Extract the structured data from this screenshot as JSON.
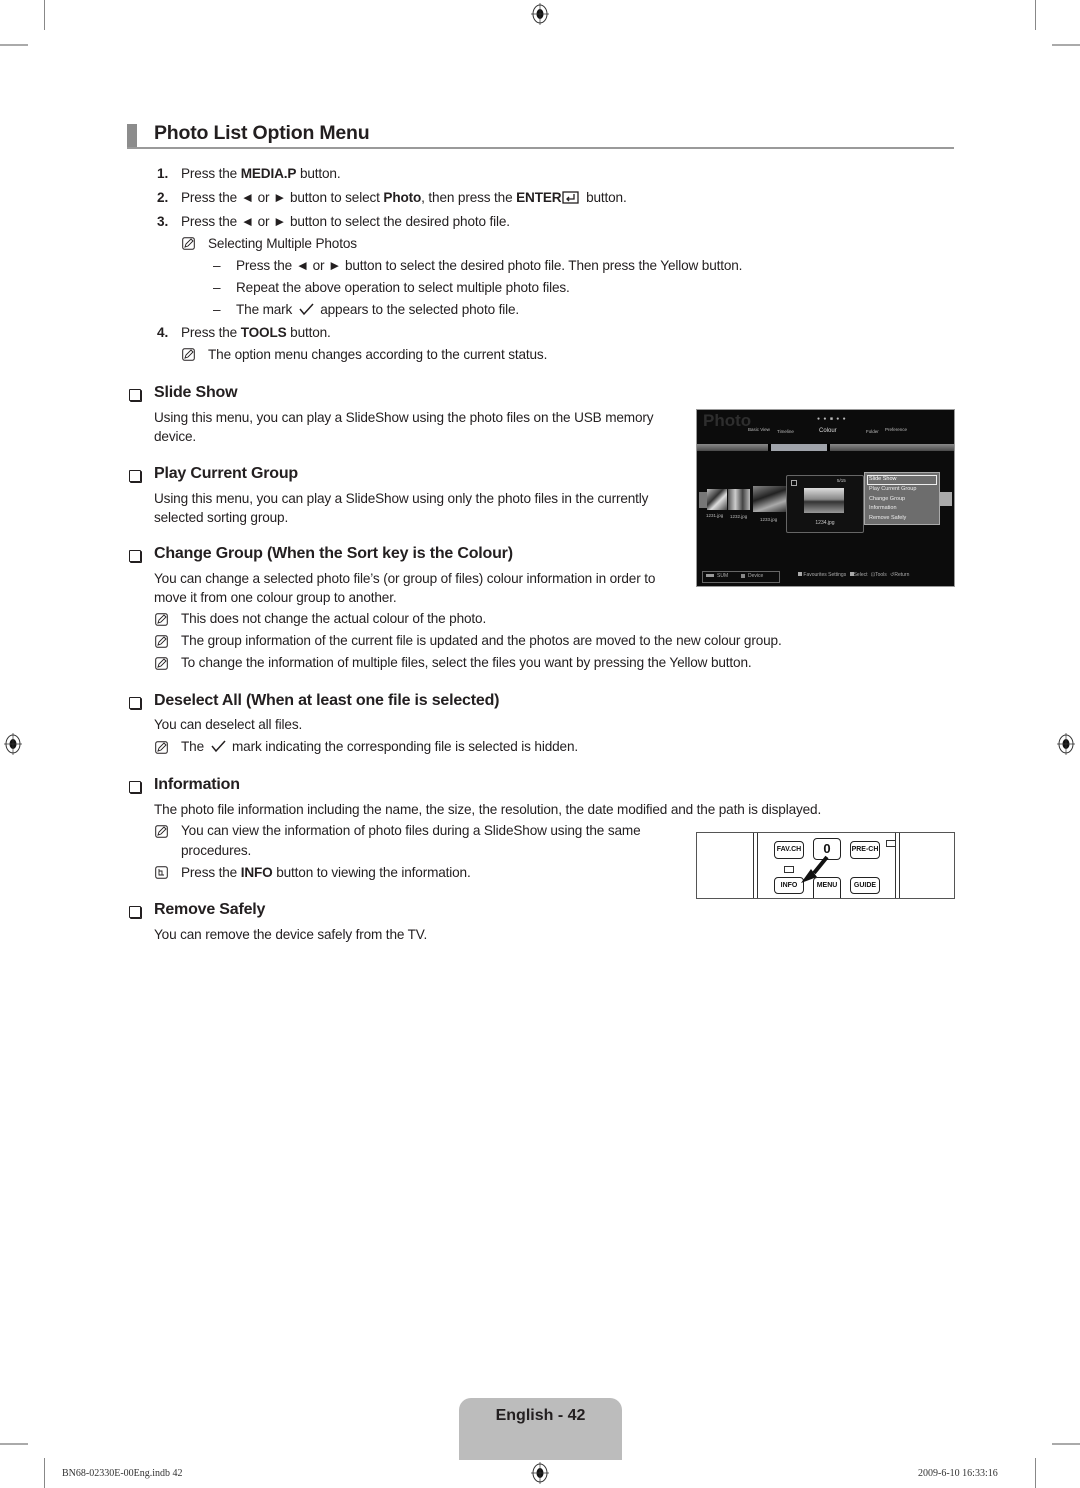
{
  "page": {
    "title": "Photo List Option Menu",
    "steps": [
      {
        "num": "1.",
        "parts": [
          "Press the ",
          "MEDIA.P",
          " button."
        ]
      },
      {
        "num": "2.",
        "parts": [
          "Press the ◄ or ► button to select ",
          "Photo",
          ", then press the ",
          "ENTER",
          " button."
        ]
      },
      {
        "num": "3.",
        "text": "Press the ◄ or ► button to select the desired photo file."
      },
      {
        "num": "4.",
        "parts": [
          "Press the ",
          "TOOLS",
          " button."
        ]
      }
    ],
    "multi_select_note": "Selecting Multiple Photos",
    "multi_select_items": [
      "Press the ◄ or ► button to select the desired photo file. Then press the Yellow button.",
      "Repeat the above operation to select multiple photo files."
    ],
    "mark_item_before": "The mark",
    "mark_item_after": "appears to the selected photo file.",
    "step4_note": "The option menu changes according to the current status.",
    "dash": "–"
  },
  "sections": {
    "slide_show": {
      "heading": "Slide Show",
      "body1": "Using this menu, you can play a SlideShow using the photo files on the USB memory",
      "body2": "device."
    },
    "play_current_group": {
      "heading": "Play Current Group",
      "body1": "Using this menu, you can play a SlideShow using only the photo files in the currently",
      "body2": "selected sorting group."
    },
    "change_group": {
      "heading": "Change Group (When the Sort key is the Colour)",
      "body1": "You can change a selected photo file’s (or group of files) colour information in order to",
      "body2": "move it from one colour group to another.",
      "notes": [
        "This does not change the actual colour of the photo.",
        "The group information of the current file is updated and the photos are moved to the new colour group.",
        "To change the information of multiple files, select the files you want by pressing the Yellow button."
      ]
    },
    "deselect_all": {
      "heading": "Deselect All (When at least one file is selected)",
      "body": "You can deselect all files.",
      "note_before": "The",
      "note_after": "mark indicating the corresponding file is selected is hidden."
    },
    "information": {
      "heading": "Information",
      "body": "The photo file information including the name, the size, the resolution, the date modified and the path is displayed.",
      "note1a": "You can view the information of photo files during a SlideShow using the same",
      "note1b": "procedures.",
      "note2_parts": [
        "Press the ",
        "INFO",
        " button to viewing the information."
      ]
    },
    "remove_safely": {
      "heading": "Remove Safely",
      "body": "You can remove the device safely from the TV."
    }
  },
  "tv_screen": {
    "title": "Photo",
    "tabs": [
      "Basic View",
      "Timeline",
      "Colour",
      "Folder",
      "Preference"
    ],
    "active_tab": "Colour",
    "thumbs": [
      "1231.jpg",
      "1232.jpg",
      "1233.jpg"
    ],
    "focused_file": "1234.jpg",
    "counter": "5/15",
    "menu_items": [
      "Slide Show",
      "Play Current Group",
      "Change Group",
      "Information",
      "Remove Safely"
    ],
    "selected_menu_item": "Slide Show",
    "bottom_left": [
      "SUM",
      "Device"
    ],
    "bottom_right": [
      "Favourites Settings",
      "Select",
      "Tools",
      "Return"
    ]
  },
  "remote": {
    "buttons": [
      "FAV.CH",
      "0",
      "PRE-CH",
      "INFO",
      "MENU",
      "GUIDE"
    ]
  },
  "footer": {
    "page_label": "English - 42",
    "file": "BN68-02330E-00Eng.indb   42",
    "timestamp": "2009-6-10   16:33:16"
  }
}
